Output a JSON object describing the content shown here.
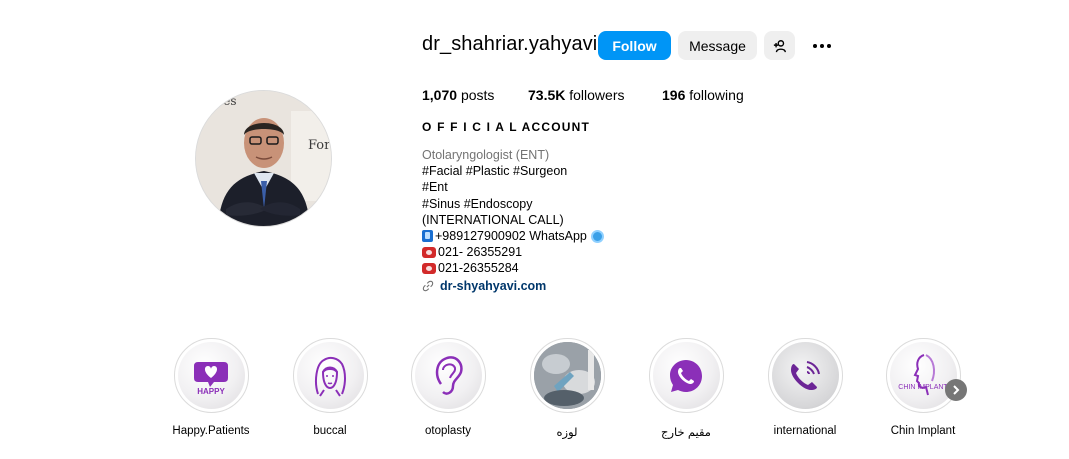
{
  "profile": {
    "username": "dr_shahriar.yahyavi",
    "follow_label": "Follow",
    "message_label": "Message",
    "stats": {
      "posts_count": "1,070",
      "posts_label": "posts",
      "followers_count": "73.5K",
      "followers_label": "followers",
      "following_count": "196",
      "following_label": "following"
    },
    "full_name": "O F F I C I A L ACCOUNT",
    "category": "Otolaryngologist (ENT)",
    "bio_lines": [
      "#Facial #Plastic #Surgeon",
      "#Ent",
      "#Sinus #Endoscopy",
      "(INTERNATIONAL CALL)",
      "+989127900902 WhatsApp",
      "021- 26355291",
      "021-26355284"
    ],
    "link": "dr-shyahyavi.com"
  },
  "highlights": [
    {
      "label": "Happy.Patients",
      "icon": "heart-happy-icon"
    },
    {
      "label": "buccal",
      "icon": "woman-face-icon"
    },
    {
      "label": "otoplasty",
      "icon": "ear-icon"
    },
    {
      "label": "لوزه",
      "icon": "photo-thumbnail"
    },
    {
      "label": "مقیم خارج",
      "icon": "whatsapp-icon"
    },
    {
      "label": "international",
      "icon": "phone-call-icon"
    },
    {
      "label": "Chin Implant",
      "icon": "face-profile-icon"
    }
  ],
  "colors": {
    "accent": "#0095f6",
    "purple": "#8b2fb8",
    "link": "#00376b"
  }
}
